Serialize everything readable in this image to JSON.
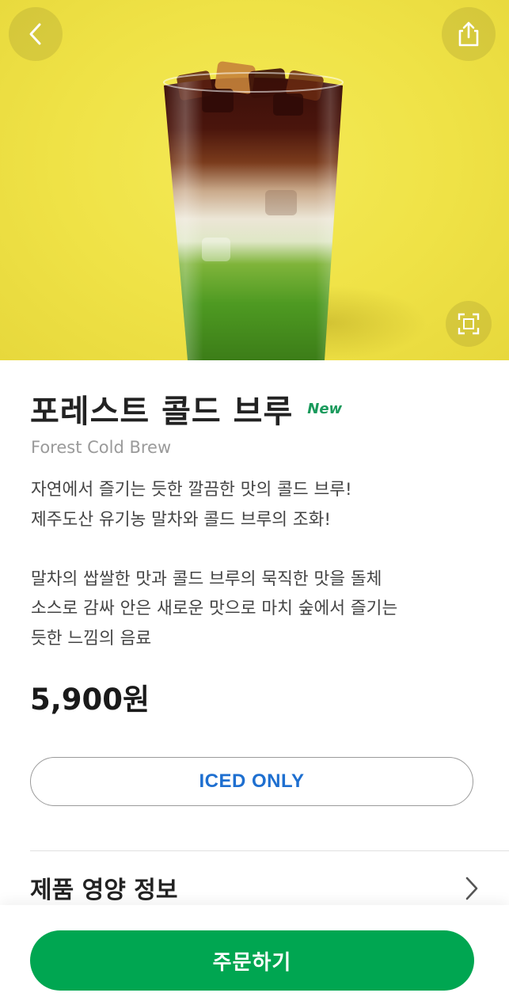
{
  "header": {
    "back_icon": "chevron-left-icon",
    "share_icon": "share-icon",
    "zoom_icon": "expand-icon"
  },
  "product": {
    "name_ko": "포레스트 콜드 브루",
    "badge": "New",
    "name_en": "Forest Cold Brew",
    "description": [
      "자연에서 즐기는 듯한 깔끔한 맛의 콜드 브루!",
      "제주도산 유기농 말차와 콜드 브루의 조화!",
      "",
      "말차의 쌉쌀한 맛과 콜드 브루의 묵직한 맛을 돌체",
      "소스로 감싸 안은 새로운 맛으로 마치 숲에서 즐기는",
      "듯한 느낌의 음료"
    ],
    "price": "5,900원",
    "temperature_option": "ICED ONLY"
  },
  "nutrition": {
    "label": "제품 영양 정보",
    "chevron_icon": "chevron-right-icon"
  },
  "order": {
    "label": "주문하기"
  },
  "colors": {
    "hero_background": "#f0e447",
    "badge_green": "#1a9a5c",
    "iced_blue": "#1e6fd0",
    "order_green": "#00a651"
  }
}
